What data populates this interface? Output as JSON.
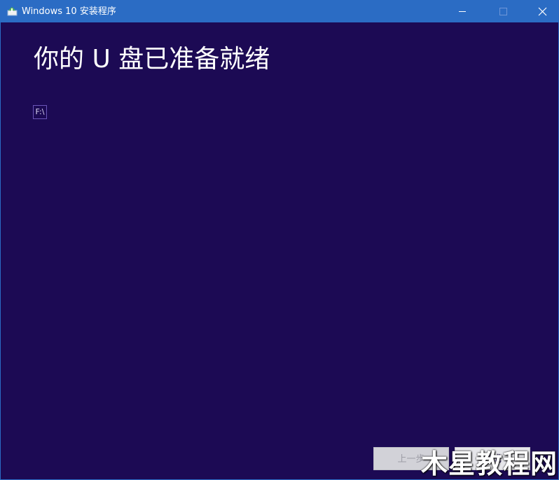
{
  "window": {
    "title": "Windows 10 安装程序",
    "background_color": "#1c0a54",
    "titlebar_color": "#2b6cc4",
    "controls": {
      "minimize_icon": "minimize-icon",
      "maximize_icon": "maximize-icon",
      "close_icon": "close-icon"
    }
  },
  "main": {
    "heading": "你的 U 盘已准备就绪",
    "drive_label": "F:\\"
  },
  "footer": {
    "back_label": "上一步",
    "finish_label": "完成"
  },
  "watermark": {
    "text": "木星教程网"
  }
}
